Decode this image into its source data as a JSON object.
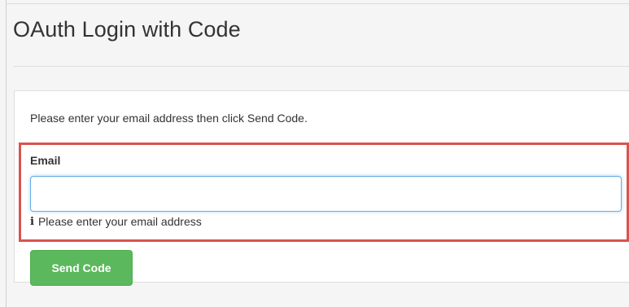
{
  "page": {
    "title": "OAuth Login with Code"
  },
  "form": {
    "instruction": "Please enter your email address then click Send Code.",
    "email_label": "Email",
    "email_value": "",
    "email_placeholder": "",
    "help_icon": "info-icon",
    "help_text": "Please enter your email address",
    "send_button_label": "Send Code"
  },
  "colors": {
    "highlight_border": "#d9534f",
    "button_background": "#5cb85c",
    "input_focus_border": "#66afe9"
  }
}
